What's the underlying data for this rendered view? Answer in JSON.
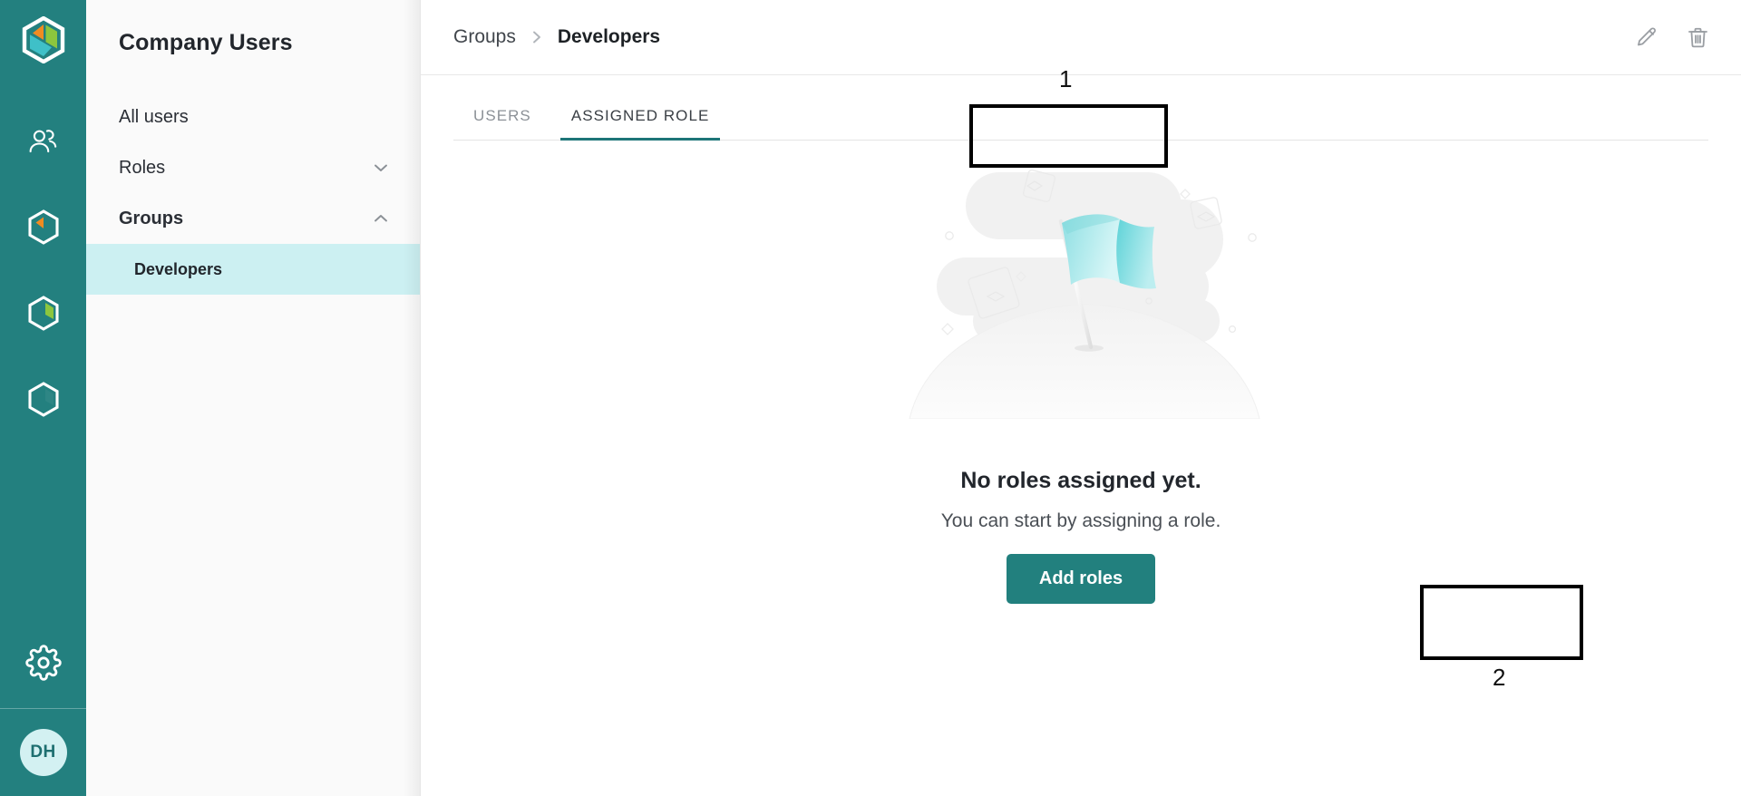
{
  "brand": {
    "logo_icon": "hexagon-logo-icon",
    "colors": {
      "teal": "#23807f",
      "accent_underline": "#1d7578",
      "selected_nav_bg": "#ccf0f2",
      "primary_button": "#22807e",
      "logo_orange": "#f08b21",
      "logo_green": "#8cc63e",
      "logo_cyan": "#3fc0c8"
    }
  },
  "rail": {
    "items": [
      {
        "name": "users-icon",
        "label": "Users"
      },
      {
        "name": "cube-orange-icon",
        "label": "Products"
      },
      {
        "name": "cube-green-icon",
        "label": "Assets"
      },
      {
        "name": "cube-white-icon",
        "label": "Modules"
      }
    ],
    "settings": {
      "name": "gear-icon",
      "label": "Settings"
    },
    "avatar": {
      "initials": "DH"
    }
  },
  "sidebar": {
    "title": "Company Users",
    "items": [
      {
        "label": "All users",
        "chevron": "none",
        "bold": false
      },
      {
        "label": "Roles",
        "chevron": "down",
        "bold": false
      },
      {
        "label": "Groups",
        "chevron": "up",
        "bold": true
      }
    ],
    "sub_items": [
      {
        "label": "Developers",
        "selected": true
      }
    ]
  },
  "topbar": {
    "breadcrumb": [
      {
        "label": "Groups",
        "current": false
      },
      {
        "label": "Developers",
        "current": true
      }
    ],
    "separator": "›",
    "actions": [
      {
        "name": "edit-pencil-icon",
        "label": "Edit"
      },
      {
        "name": "delete-trash-icon",
        "label": "Delete"
      }
    ]
  },
  "tabs": [
    {
      "label": "Users",
      "active": false
    },
    {
      "label": "Assigned Role",
      "active": true
    }
  ],
  "empty_state": {
    "illustration": "flag-on-hill-illustration",
    "title": "No roles assigned yet.",
    "subtitle": "You can start by assigning a role.",
    "button_label": "Add roles"
  },
  "annotations": [
    {
      "id": 1,
      "number": "1",
      "target": "assigned-role-tab"
    },
    {
      "id": 2,
      "number": "2",
      "target": "add-roles-button"
    }
  ]
}
